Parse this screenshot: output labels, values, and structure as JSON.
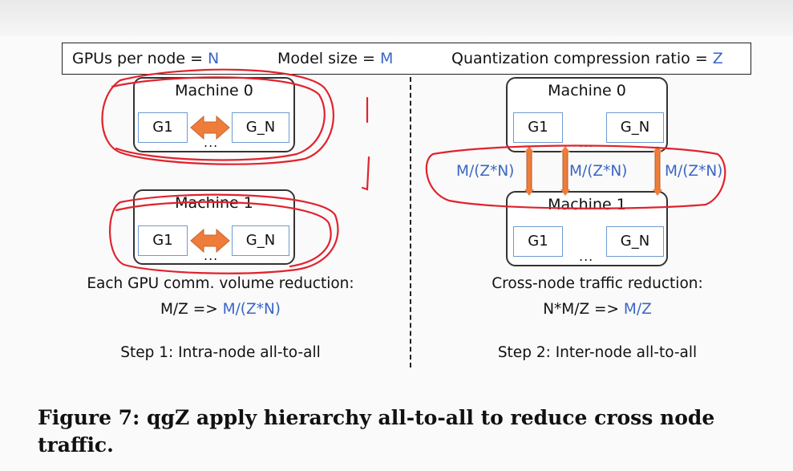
{
  "legend": {
    "gpus_label": "GPUs per node = ",
    "gpus_var": "N",
    "model_label": "Model size = ",
    "model_var": "M",
    "ratio_label": "Quantization compression ratio = ",
    "ratio_var": "Z"
  },
  "step1": {
    "machine0": "Machine 0",
    "machine1": "Machine 1",
    "g1": "G1",
    "gn": "G_N",
    "dots": "...",
    "reduction_title": "Each GPU comm. volume reduction:",
    "reduction_from": "M/Z => ",
    "reduction_to": "M/(Z*N)",
    "step_label": "Step 1: Intra-node all-to-all"
  },
  "step2": {
    "machine0": "Machine 0",
    "machine1": "Machine 1",
    "g1": "G1",
    "gn": "G_N",
    "dots": "...",
    "flow_labels": [
      "M/(Z*N)",
      "M/(Z*N)",
      "M/(Z*N)"
    ],
    "reduction_title": "Cross-node traffic reduction:",
    "reduction_from": "N*M/Z => ",
    "reduction_to": "M/Z",
    "step_label": "Step 2: Inter-node all-to-all"
  },
  "caption": "Figure 7: qgZ apply hierarchy all-to-all to reduce cross node traffic.",
  "colors": {
    "accent_blue": "#3b66c4",
    "gpu_border": "#6e9bd0",
    "arrow_orange": "#ee7d3b",
    "annotation_red": "#e0232d"
  }
}
